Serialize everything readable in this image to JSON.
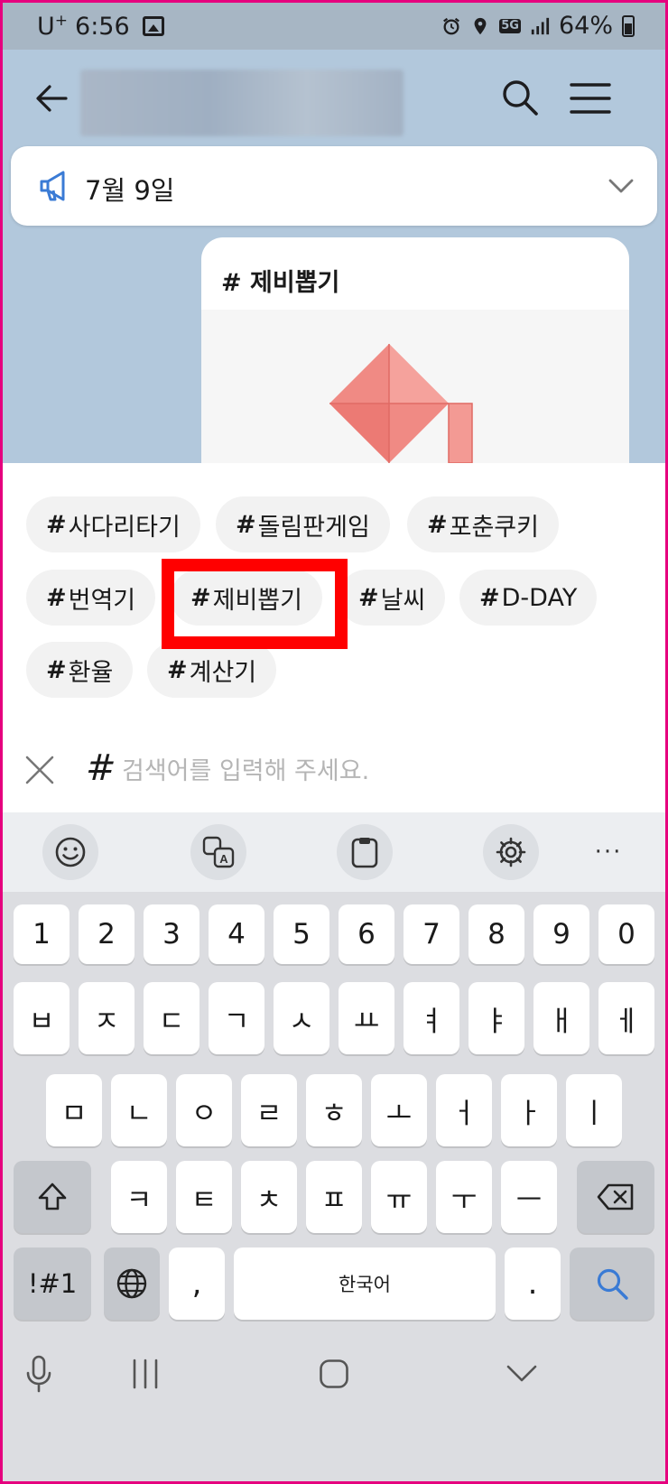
{
  "status_bar": {
    "carrier": "U",
    "carrier_sup": "+",
    "time": "6:56",
    "network": "5G",
    "battery": "64%"
  },
  "notice": {
    "text": "7월 9일"
  },
  "card": {
    "title": "# 제비뽑기"
  },
  "chips": [
    {
      "hash": "#",
      "label": "사다리타기"
    },
    {
      "hash": "#",
      "label": "돌림판게임"
    },
    {
      "hash": "#",
      "label": "포춘쿠키"
    },
    {
      "hash": "#",
      "label": "번역기"
    },
    {
      "hash": "#",
      "label": "제비뽑기"
    },
    {
      "hash": "#",
      "label": "날씨"
    },
    {
      "hash": "#",
      "label": "D-DAY"
    },
    {
      "hash": "#",
      "label": "환율"
    },
    {
      "hash": "#",
      "label": "계산기"
    }
  ],
  "search": {
    "hash": "#",
    "placeholder": "검색어를 입력해 주세요.",
    "value": ""
  },
  "keyboard": {
    "toolbar_icons": [
      "emoji-icon",
      "translate-icon",
      "clipboard-icon",
      "settings-icon",
      "more-icon"
    ],
    "more_label": "···",
    "row_numbers": [
      "1",
      "2",
      "3",
      "4",
      "5",
      "6",
      "7",
      "8",
      "9",
      "0"
    ],
    "row1": [
      "ㅂ",
      "ㅈ",
      "ㄷ",
      "ㄱ",
      "ㅅ",
      "ㅛ",
      "ㅕ",
      "ㅑ",
      "ㅐ",
      "ㅔ"
    ],
    "row2": [
      "ㅁ",
      "ㄴ",
      "ㅇ",
      "ㄹ",
      "ㅎ",
      "ㅗ",
      "ㅓ",
      "ㅏ",
      "ㅣ"
    ],
    "row3": [
      "ㅋ",
      "ㅌ",
      "ㅊ",
      "ㅍ",
      "ㅠ",
      "ㅜ",
      "ㅡ"
    ],
    "symbols_label": "!#1",
    "comma_label": ",",
    "space_label": "한국어",
    "period_label": "."
  },
  "colors": {
    "accent_blue": "#3a7bd5",
    "highlight_red": "#ff0000",
    "art_pink": "#f08a84"
  }
}
